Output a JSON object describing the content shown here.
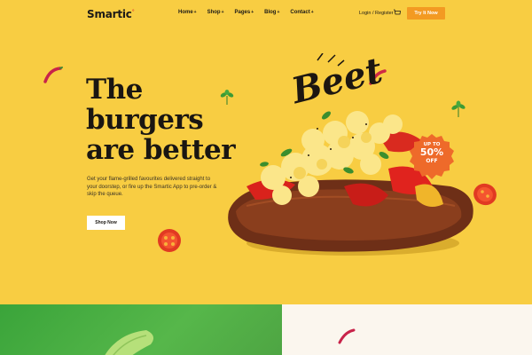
{
  "header": {
    "logo": "Smartic",
    "logo_mark": "°",
    "nav": [
      {
        "label": "Home"
      },
      {
        "label": "Shop"
      },
      {
        "label": "Pages"
      },
      {
        "label": "Blog"
      },
      {
        "label": "Contact"
      }
    ],
    "login_label": "Login / Register",
    "cta_label": "Try It Now"
  },
  "hero": {
    "headline_lines": [
      "The",
      "burgers",
      "are better"
    ],
    "description": "Get your flame-grilled favourites delivered straight to your doorstep, or fire up the Smartic App to pre-order & skip the queue.",
    "button_label": "Shop Now",
    "script_word": "Beet",
    "badge": {
      "line1": "UP TO",
      "line2": "50%",
      "line3": "OFF"
    }
  },
  "colors": {
    "hero_bg": "#f8cd42",
    "accent_orange": "#f39a22",
    "badge": "#ee6a2a",
    "green_section": "#4eaf45",
    "cream_section": "#fbf6ee"
  },
  "icons": [
    "caret-down-icon",
    "cart-icon",
    "chili-icon",
    "leaf-icon",
    "tomato-icon"
  ]
}
